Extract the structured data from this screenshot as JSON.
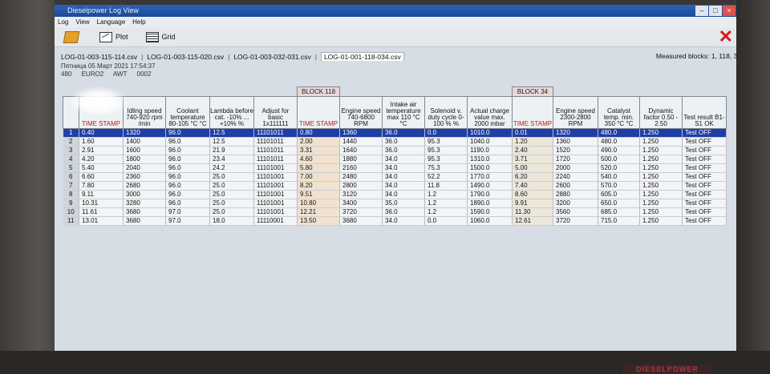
{
  "window": {
    "title": "Dieselpower Log View"
  },
  "menu": [
    "Log",
    "View",
    "Language",
    "Help"
  ],
  "toolbar": {
    "plot_label": "Plot",
    "grid_label": "Grid"
  },
  "tabs": [
    {
      "label": "LOG-01-003-115-114.csv",
      "active": false
    },
    {
      "label": "LOG-01-003-115-020.csv",
      "active": false
    },
    {
      "label": "LOG-01-003-032-031.csv",
      "active": false
    },
    {
      "label": "LOG-01-001-118-034.csv",
      "active": true
    }
  ],
  "measured_blocks": "Measured blocks: 1, 118, 34",
  "info": {
    "line1": "Пятница 05 Март 2021 17:54:37",
    "vin": "480",
    "code": "EURO2",
    "awt": "AWT",
    "num": "0002"
  },
  "block_labels": {
    "b118": "BLOCK 118",
    "b34": "BLOCK 34"
  },
  "headers": {
    "time1": "TIME STAMP",
    "idle": "Idling speed 740-920 rpm /min",
    "coolant": "Coolant temperature 80-105 °C °C",
    "lambda": "Lambda before cat. -10% ... +10% %",
    "adjust": "Adjust for basic 1x111111",
    "time2": "TIME STAMP",
    "eng1": "Engine speed 740-6800 RPM",
    "intake": "Intake air temperature max 110 °C °C",
    "solenoid": "Solenoid v. duty cycle 0-100 % %",
    "charge": "Actual charge value max. 2000 mbar",
    "time3": "TIME STAMP",
    "eng2": "Engine speed 2300-2800 RPM",
    "catalyst": "Catalyst temp. min. 350 °C °C",
    "dynamic": "Dynamic factor 0.50 - 2.50",
    "test": "Test result B1-S1 OK"
  },
  "rows": [
    {
      "i": "1",
      "t1": "0.40",
      "idle": "1320",
      "cool": "96.0",
      "lam": "12.5",
      "adj": "11101011",
      "t2": "0.80",
      "eng": "1360",
      "air": "36.0",
      "sol": "0.0",
      "chg": "1010.0",
      "t3": "0.01",
      "eng2": "1320",
      "cat": "480.0",
      "dyn": "1.250",
      "test": "Test OFF"
    },
    {
      "i": "2",
      "t1": "1.60",
      "idle": "1400",
      "cool": "96.0",
      "lam": "12.5",
      "adj": "11101011",
      "t2": "2.00",
      "eng": "1440",
      "air": "36.0",
      "sol": "95.3",
      "chg": "1040.0",
      "t3": "1.20",
      "eng2": "1360",
      "cat": "480.0",
      "dyn": "1.250",
      "test": "Test OFF"
    },
    {
      "i": "3",
      "t1": "2.91",
      "idle": "1600",
      "cool": "96.0",
      "lam": "21.9",
      "adj": "11101011",
      "t2": "3.31",
      "eng": "1640",
      "air": "36.0",
      "sol": "95.3",
      "chg": "1190.0",
      "t3": "2.40",
      "eng2": "1520",
      "cat": "490.0",
      "dyn": "1.250",
      "test": "Test OFF"
    },
    {
      "i": "4",
      "t1": "4.20",
      "idle": "1800",
      "cool": "96.0",
      "lam": "23.4",
      "adj": "11101011",
      "t2": "4.60",
      "eng": "1880",
      "air": "34.0",
      "sol": "95.3",
      "chg": "1310.0",
      "t3": "3.71",
      "eng2": "1720",
      "cat": "500.0",
      "dyn": "1.250",
      "test": "Test OFF"
    },
    {
      "i": "5",
      "t1": "5.40",
      "idle": "2040",
      "cool": "96.0",
      "lam": "24.2",
      "adj": "11101001",
      "t2": "5.80",
      "eng": "2160",
      "air": "34.0",
      "sol": "75.3",
      "chg": "1500.0",
      "t3": "5.00",
      "eng2": "2000",
      "cat": "520.0",
      "dyn": "1.250",
      "test": "Test OFF"
    },
    {
      "i": "6",
      "t1": "6.60",
      "idle": "2360",
      "cool": "96.0",
      "lam": "25.0",
      "adj": "11101001",
      "t2": "7.00",
      "eng": "2480",
      "air": "34.0",
      "sol": "52.2",
      "chg": "1770.0",
      "t3": "6.20",
      "eng2": "2240",
      "cat": "540.0",
      "dyn": "1.250",
      "test": "Test OFF"
    },
    {
      "i": "7",
      "t1": "7.80",
      "idle": "2680",
      "cool": "96.0",
      "lam": "25.0",
      "adj": "11101001",
      "t2": "8.20",
      "eng": "2800",
      "air": "34.0",
      "sol": "11.8",
      "chg": "1490.0",
      "t3": "7.40",
      "eng2": "2600",
      "cat": "570.0",
      "dyn": "1.250",
      "test": "Test OFF"
    },
    {
      "i": "8",
      "t1": "9.11",
      "idle": "3000",
      "cool": "96.0",
      "lam": "25.0",
      "adj": "11101001",
      "t2": "9.51",
      "eng": "3120",
      "air": "34.0",
      "sol": "1.2",
      "chg": "1790.0",
      "t3": "8.60",
      "eng2": "2880",
      "cat": "605.0",
      "dyn": "1.250",
      "test": "Test OFF"
    },
    {
      "i": "9",
      "t1": "10.31",
      "idle": "3280",
      "cool": "96.0",
      "lam": "25.0",
      "adj": "11101001",
      "t2": "10.80",
      "eng": "3400",
      "air": "35.0",
      "sol": "1.2",
      "chg": "1890.0",
      "t3": "9.91",
      "eng2": "3200",
      "cat": "650.0",
      "dyn": "1.250",
      "test": "Test OFF"
    },
    {
      "i": "10",
      "t1": "11.61",
      "idle": "3680",
      "cool": "97.0",
      "lam": "25.0",
      "adj": "11101001",
      "t2": "12.21",
      "eng": "3720",
      "air": "36.0",
      "sol": "1.2",
      "chg": "1590.0",
      "t3": "11.30",
      "eng2": "3560",
      "cat": "685.0",
      "dyn": "1.250",
      "test": "Test OFF"
    },
    {
      "i": "11",
      "t1": "13.01",
      "idle": "3680",
      "cool": "97.0",
      "lam": "18.0",
      "adj": "11110001",
      "t2": "13.50",
      "eng": "3680",
      "air": "34.0",
      "sol": "0.0",
      "chg": "1060.0",
      "t3": "12.61",
      "eng2": "3720",
      "cat": "715.0",
      "dyn": "1.250",
      "test": "Test OFF"
    }
  ],
  "brand": "DIESELPOWER"
}
